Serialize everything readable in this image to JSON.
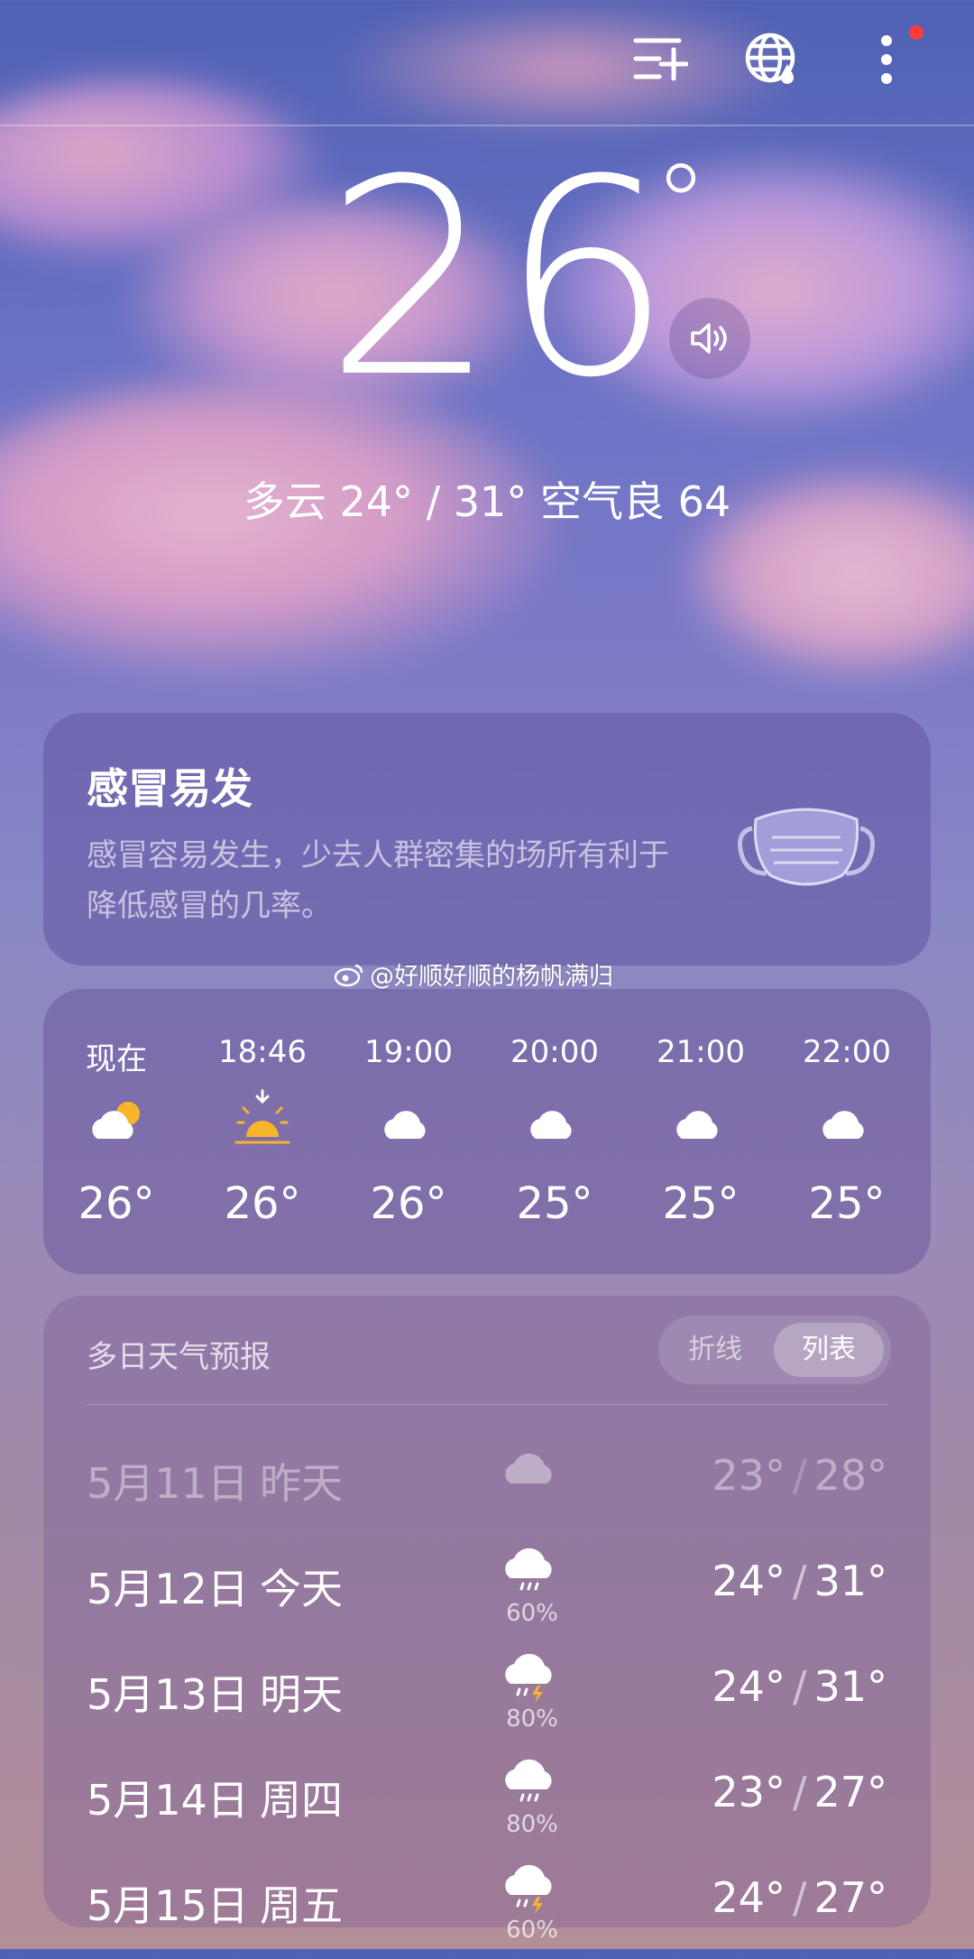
{
  "header": {
    "icons": [
      "add-city-icon",
      "global-weather-icon",
      "more-icon"
    ]
  },
  "current": {
    "temperature": "26",
    "degree": "°",
    "summary": "多云  24° / 31°  空气良 64"
  },
  "tip": {
    "title": "感冒易发",
    "text": "感冒容易发生，少去人群密集的场所有利于降低感冒的几率。",
    "icon": "mask-icon"
  },
  "watermark": "@好顺好顺的杨帆满归",
  "hourly": [
    {
      "time": "现在",
      "icon": "cloudy-sun-icon",
      "temp": "26°"
    },
    {
      "time": "18:46",
      "icon": "sunset-icon",
      "temp": "26°"
    },
    {
      "time": "19:00",
      "icon": "cloudy-moon-icon",
      "temp": "26°"
    },
    {
      "time": "20:00",
      "icon": "cloudy-moon-icon",
      "temp": "25°"
    },
    {
      "time": "21:00",
      "icon": "cloudy-moon-icon",
      "temp": "25°"
    },
    {
      "time": "22:00",
      "icon": "cloudy-moon-icon",
      "temp": "25°"
    }
  ],
  "daily": {
    "title": "多日天气预报",
    "toggle": {
      "line": "折线",
      "list": "列表",
      "selected": "列表"
    },
    "rows": [
      {
        "date": "5月11日",
        "day": "昨天",
        "icon": "cloud-icon",
        "prob": "",
        "low": "23°",
        "high": "28°"
      },
      {
        "date": "5月12日",
        "day": "今天",
        "icon": "rain-icon",
        "prob": "60%",
        "low": "24°",
        "high": "31°"
      },
      {
        "date": "5月13日",
        "day": "明天",
        "icon": "thunder-rain-icon",
        "prob": "80%",
        "low": "24°",
        "high": "31°"
      },
      {
        "date": "5月14日",
        "day": "周四",
        "icon": "rain-icon",
        "prob": "80%",
        "low": "23°",
        "high": "27°"
      },
      {
        "date": "5月15日",
        "day": "周五",
        "icon": "thunder-rain-icon",
        "prob": "60%",
        "low": "24°",
        "high": "27°"
      }
    ]
  },
  "colors": {
    "accent_sun": "#f7b52b",
    "badge": "#ff3b3b"
  }
}
